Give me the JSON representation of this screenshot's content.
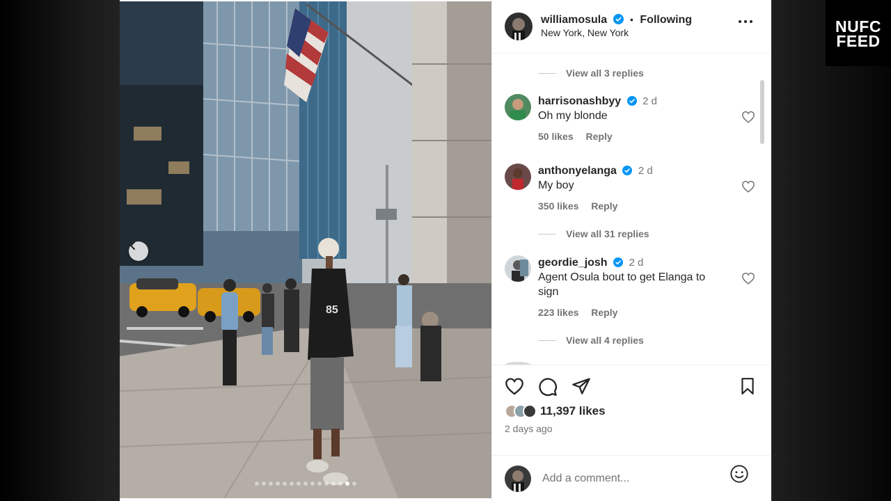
{
  "badge": {
    "line1": "NUFC",
    "line2": "FEED"
  },
  "post": {
    "username": "williamosula",
    "following": "Following",
    "separator": "•",
    "location": "New York, New York",
    "likes": "11,397 likes",
    "time_ago": "2 days ago",
    "add_comment_placeholder": "Add a comment...",
    "carousel": {
      "total": 15,
      "active": 14
    }
  },
  "comments": {
    "replies_1": "View all 3 replies",
    "items": [
      {
        "user": "harrisonashbyy",
        "time": "2 d",
        "text": "Oh my blonde",
        "likes": "50 likes",
        "reply": "Reply"
      },
      {
        "user": "anthonyelanga",
        "time": "2 d",
        "text": "My boy",
        "likes": "350 likes",
        "reply": "Reply"
      },
      {
        "user": "geordie_josh",
        "time": "2 d",
        "text": "Agent Osula bout to get Elanga to sign",
        "likes": "223 likes",
        "reply": "Reply"
      }
    ],
    "replies_2": "View all 31 replies",
    "replies_3": "View all 4 replies"
  },
  "colors": {
    "verified": "#0095f6",
    "muted": "#737373",
    "text": "#262626"
  }
}
